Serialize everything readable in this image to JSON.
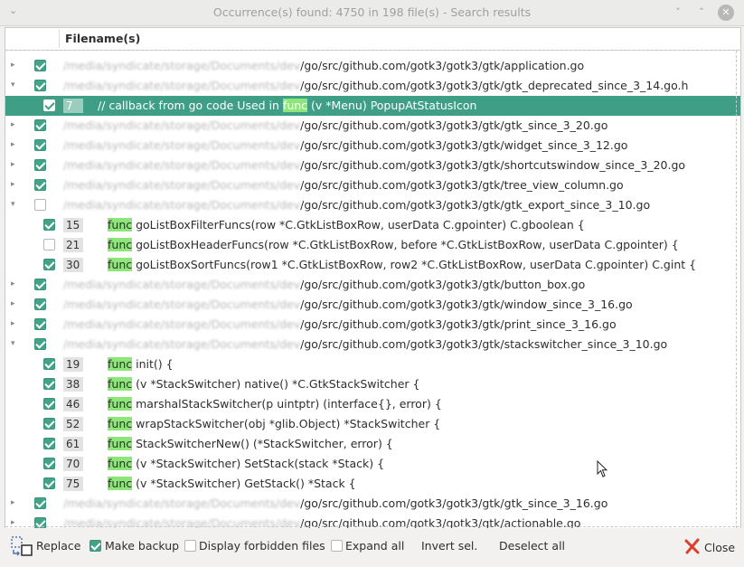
{
  "window": {
    "title": "Occurrence(s) found: 4750 in 198 file(s) - Search results",
    "menu_glyph": "⌄",
    "min_glyph": "˅",
    "max_glyph": "˄",
    "close_glyph": "✕"
  },
  "table": {
    "header_filename": "Filename(s)"
  },
  "rows": [
    {
      "type": "file",
      "expanded": false,
      "checked": true,
      "prefix": "/media/syndicate/storage/Documents/dev",
      "suffix": "/go/src/github.com/gotk3/gotk3/gtk/application.go"
    },
    {
      "type": "file",
      "expanded": true,
      "checked": true,
      "prefix": "/media/syndicate/storage/Documents/dev",
      "suffix": "/go/src/github.com/gotk3/gotk3/gtk/gtk_deprecated_since_3_14.go.h"
    },
    {
      "type": "line",
      "checked": true,
      "selected": true,
      "line": "7",
      "pre": "// callback from go code Used in ",
      "kw": "func",
      "post": " (v *Menu) PopupAtStatusIcon"
    },
    {
      "type": "file",
      "expanded": false,
      "checked": true,
      "prefix": "/media/syndicate/storage/Documents/dev",
      "suffix": "/go/src/github.com/gotk3/gotk3/gtk/gtk_since_3_20.go"
    },
    {
      "type": "file",
      "expanded": false,
      "checked": true,
      "prefix": "/media/syndicate/storage/Documents/dev",
      "suffix": "/go/src/github.com/gotk3/gotk3/gtk/widget_since_3_12.go"
    },
    {
      "type": "file",
      "expanded": false,
      "checked": true,
      "prefix": "/media/syndicate/storage/Documents/dev",
      "suffix": "/go/src/github.com/gotk3/gotk3/gtk/shortcutswindow_since_3_20.go"
    },
    {
      "type": "file",
      "expanded": false,
      "checked": true,
      "prefix": "/media/syndicate/storage/Documents/dev",
      "suffix": "/go/src/github.com/gotk3/gotk3/gtk/tree_view_column.go"
    },
    {
      "type": "file",
      "expanded": true,
      "checked": false,
      "prefix": "/media/syndicate/storage/Documents/dev",
      "suffix": "/go/src/github.com/gotk3/gotk3/gtk/gtk_export_since_3_10.go"
    },
    {
      "type": "line",
      "checked": true,
      "selected": false,
      "line": "15",
      "pre": "",
      "kw": "func",
      "post": " goListBoxFilterFuncs(row *C.GtkListBoxRow, userData C.gpointer) C.gboolean {"
    },
    {
      "type": "line",
      "checked": false,
      "selected": false,
      "line": "21",
      "pre": "",
      "kw": "func",
      "post": " goListBoxHeaderFuncs(row *C.GtkListBoxRow, before *C.GtkListBoxRow, userData C.gpointer) {"
    },
    {
      "type": "line",
      "checked": true,
      "selected": false,
      "line": "30",
      "pre": "",
      "kw": "func",
      "post": " goListBoxSortFuncs(row1 *C.GtkListBoxRow, row2 *C.GtkListBoxRow, userData C.gpointer) C.gint {"
    },
    {
      "type": "file",
      "expanded": false,
      "checked": true,
      "prefix": "/media/syndicate/storage/Documents/dev",
      "suffix": "/go/src/github.com/gotk3/gotk3/gtk/button_box.go"
    },
    {
      "type": "file",
      "expanded": false,
      "checked": true,
      "prefix": "/media/syndicate/storage/Documents/dev",
      "suffix": "/go/src/github.com/gotk3/gotk3/gtk/window_since_3_16.go"
    },
    {
      "type": "file",
      "expanded": false,
      "checked": true,
      "prefix": "/media/syndicate/storage/Documents/dev",
      "suffix": "/go/src/github.com/gotk3/gotk3/gtk/print_since_3_16.go"
    },
    {
      "type": "file",
      "expanded": true,
      "checked": true,
      "prefix": "/media/syndicate/storage/Documents/dev",
      "suffix": "/go/src/github.com/gotk3/gotk3/gtk/stackswitcher_since_3_10.go"
    },
    {
      "type": "line",
      "checked": true,
      "selected": false,
      "line": "19",
      "pre": "",
      "kw": "func",
      "post": " init() {"
    },
    {
      "type": "line",
      "checked": true,
      "selected": false,
      "line": "38",
      "pre": "",
      "kw": "func",
      "post": " (v *StackSwitcher) native() *C.GtkStackSwitcher {"
    },
    {
      "type": "line",
      "checked": true,
      "selected": false,
      "line": "46",
      "pre": "",
      "kw": "func",
      "post": " marshalStackSwitcher(p uintptr) (interface{}, error) {"
    },
    {
      "type": "line",
      "checked": true,
      "selected": false,
      "line": "52",
      "pre": "",
      "kw": "func",
      "post": " wrapStackSwitcher(obj *glib.Object) *StackSwitcher {"
    },
    {
      "type": "line",
      "checked": true,
      "selected": false,
      "line": "61",
      "pre": "",
      "kw": "func",
      "post": " StackSwitcherNew() (*StackSwitcher, error) {"
    },
    {
      "type": "line",
      "checked": true,
      "selected": false,
      "line": "70",
      "pre": "",
      "kw": "func",
      "post": " (v *StackSwitcher) SetStack(stack *Stack) {"
    },
    {
      "type": "line",
      "checked": true,
      "selected": false,
      "line": "75",
      "pre": "",
      "kw": "func",
      "post": " (v *StackSwitcher) GetStack() *Stack {"
    },
    {
      "type": "file",
      "expanded": false,
      "checked": true,
      "prefix": "/media/syndicate/storage/Documents/dev",
      "suffix": "/go/src/github.com/gotk3/gotk3/gtk/gtk_since_3_16.go"
    },
    {
      "type": "file",
      "expanded": false,
      "checked": true,
      "prefix": "/media/syndicate/storage/Documents/dev",
      "suffix": "/go/src/github.com/gotk3/gotk3/gtk/actionable.go"
    }
  ],
  "bottom": {
    "replace": "Replace",
    "make_backup": "Make backup",
    "make_backup_checked": true,
    "display_forbidden": "Display forbidden files",
    "display_forbidden_checked": false,
    "expand_all": "Expand all",
    "expand_all_checked": false,
    "invert_sel": "Invert sel.",
    "deselect_all": "Deselect all",
    "close": "Close"
  },
  "colors": {
    "accent": "#42a388",
    "selection": "#3f9f86",
    "keyword_highlight": "#8ee67a",
    "close_icon": "#d9412e"
  }
}
